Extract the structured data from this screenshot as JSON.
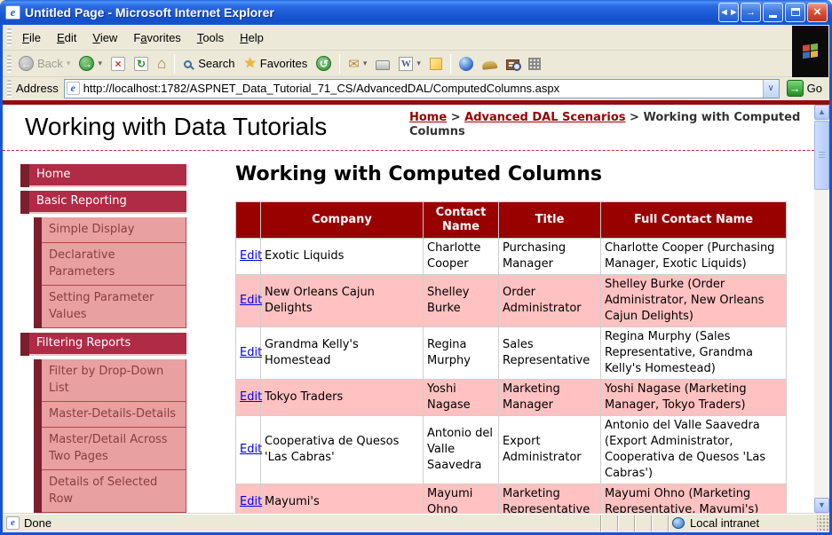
{
  "window": {
    "title": "Untitled Page - Microsoft Internet Explorer"
  },
  "menu": {
    "items": [
      {
        "label": "File",
        "accel_index": "0"
      },
      {
        "label": "Edit",
        "accel_index": "0"
      },
      {
        "label": "View",
        "accel_index": "0"
      },
      {
        "label": "Favorites",
        "accel_index": "1"
      },
      {
        "label": "Tools",
        "accel_index": "0"
      },
      {
        "label": "Help",
        "accel_index": "0"
      }
    ]
  },
  "toolbar": {
    "back_label": "Back",
    "search_label": "Search",
    "favorites_label": "Favorites"
  },
  "address": {
    "label": "Address",
    "url": "http://localhost:1782/ASPNET_Data_Tutorial_71_CS/AdvancedDAL/ComputedColumns.aspx",
    "go_label": "Go"
  },
  "header": {
    "site_title": "Working with Data Tutorials",
    "breadcrumb": {
      "separator": ">",
      "items": [
        {
          "label": "Home",
          "is_link": true
        },
        {
          "label": "Advanced DAL Scenarios",
          "is_link": true
        },
        {
          "label": "Working with Computed Columns",
          "is_link": false
        }
      ]
    }
  },
  "sidebar": {
    "items": [
      {
        "type": "header",
        "label": "Home"
      },
      {
        "type": "header",
        "label": "Basic Reporting"
      },
      {
        "type": "sub",
        "label": "Simple Display"
      },
      {
        "type": "sub",
        "label": "Declarative Parameters"
      },
      {
        "type": "sub",
        "label": "Setting Parameter Values"
      },
      {
        "type": "header",
        "label": "Filtering Reports"
      },
      {
        "type": "sub",
        "label": "Filter by Drop-Down List"
      },
      {
        "type": "sub",
        "label": "Master-Details-Details"
      },
      {
        "type": "sub",
        "label": "Master/Detail Across Two Pages"
      },
      {
        "type": "sub",
        "label": "Details of Selected Row"
      }
    ]
  },
  "main": {
    "heading": "Working with Computed Columns",
    "table": {
      "edit_label": "Edit",
      "columns": [
        "",
        "Company",
        "Contact Name",
        "Title",
        "Full Contact Name"
      ],
      "rows": [
        {
          "company": "Exotic Liquids",
          "contact": "Charlotte Cooper",
          "title": "Purchasing Manager",
          "full": "Charlotte Cooper (Purchasing Manager, Exotic Liquids)"
        },
        {
          "company": "New Orleans Cajun Delights",
          "contact": "Shelley Burke",
          "title": "Order Administrator",
          "full": "Shelley Burke (Order Administrator, New Orleans Cajun Delights)"
        },
        {
          "company": "Grandma Kelly's Homestead",
          "contact": "Regina Murphy",
          "title": "Sales Representative",
          "full": "Regina Murphy (Sales Representative, Grandma Kelly's Homestead)"
        },
        {
          "company": "Tokyo Traders",
          "contact": "Yoshi Nagase",
          "title": "Marketing Manager",
          "full": "Yoshi Nagase (Marketing Manager, Tokyo Traders)"
        },
        {
          "company": "Cooperativa de Quesos 'Las Cabras'",
          "contact": "Antonio del Valle Saavedra",
          "title": "Export Administrator",
          "full": "Antonio del Valle Saavedra (Export Administrator, Cooperativa de Quesos 'Las Cabras')"
        },
        {
          "company": "Mayumi's",
          "contact": "Mayumi Ohno",
          "title": "Marketing Representative",
          "full": "Mayumi Ohno (Marketing Representative, Mayumi's)"
        }
      ]
    }
  },
  "statusbar": {
    "left": "Done",
    "right": "Local intranet"
  },
  "colors": {
    "titlebar_blue": "#1B59D6",
    "window_border": "#1455D6",
    "chrome_bg": "#ECE9D8",
    "maroon": "#990000",
    "sidebar_header_bg": "#B02B46",
    "sidebar_notch": "#7A1F2B",
    "sidebar_sub_bg": "#E8A0A0",
    "sidebar_sub_text": "#8B3E3E",
    "row_alt_pink": "#FFC1C1",
    "link_blue": "#0000EE",
    "breadcrumb_link": "#990000"
  }
}
